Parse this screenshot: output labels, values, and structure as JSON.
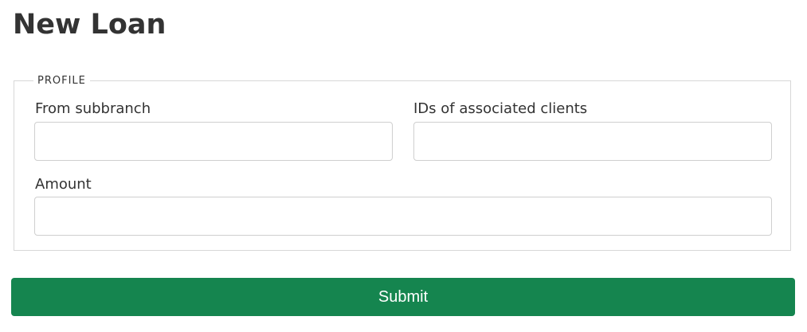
{
  "page": {
    "title": "New Loan"
  },
  "form": {
    "section_legend": "PROFILE",
    "fields": {
      "from_subbranch": {
        "label": "From subbranch",
        "value": "",
        "placeholder": ""
      },
      "associated_clients": {
        "label": "IDs of associated clients",
        "value": "",
        "placeholder": ""
      },
      "amount": {
        "label": "Amount",
        "value": "",
        "placeholder": ""
      }
    },
    "submit_label": "Submit"
  },
  "colors": {
    "submit_background": "#15854f",
    "text": "#333333",
    "border": "#d7d7d7"
  }
}
